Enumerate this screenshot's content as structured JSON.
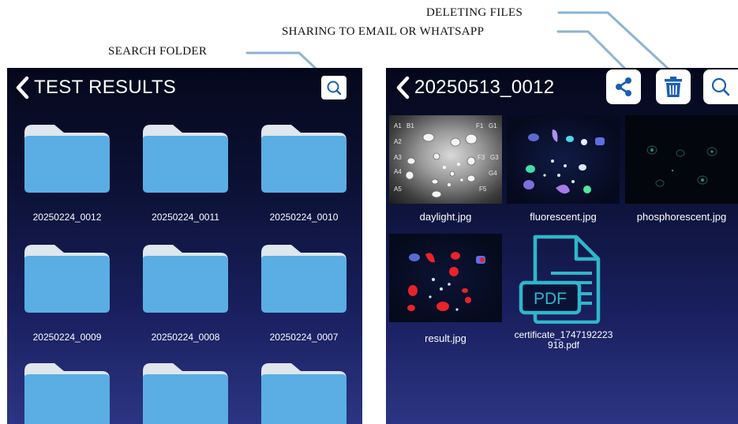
{
  "callouts": {
    "deleting": "DELETING FILES",
    "sharing": "SHARING TO EMAIL OR WHATSAPP",
    "search": "SEARCH FOLDER"
  },
  "left": {
    "title": "TEST RESULTS",
    "folders": [
      "20250224_0012",
      "20250224_0011",
      "20250224_0010",
      "20250224_0009",
      "20250224_0008",
      "20250224_0007",
      "",
      "",
      ""
    ]
  },
  "right": {
    "title": "20250513_0012",
    "files": [
      {
        "name": "daylight.jpg"
      },
      {
        "name": "fluorescent.jpg"
      },
      {
        "name": "phosphorescent.jpg"
      },
      {
        "name": "result.jpg"
      },
      {
        "name_line1": "certificate_1747192223",
        "name_line2": "918.pdf",
        "badge": "PDF"
      }
    ]
  },
  "colors": {
    "folder_body": "#5aaee3",
    "folder_tab": "#dfe6ee",
    "screen_bg_top": "#05081c",
    "screen_bg_bottom": "#2c3583",
    "leader_line": "#8eb2d4",
    "pdf_accent": "#2fb7c9",
    "result_red": "#e8232a",
    "trash_blue": "#1a5fb4"
  },
  "icons": [
    "chevron-left-icon",
    "search-icon",
    "share-icon",
    "trash-icon",
    "folder-icon",
    "pdf-file-icon"
  ]
}
